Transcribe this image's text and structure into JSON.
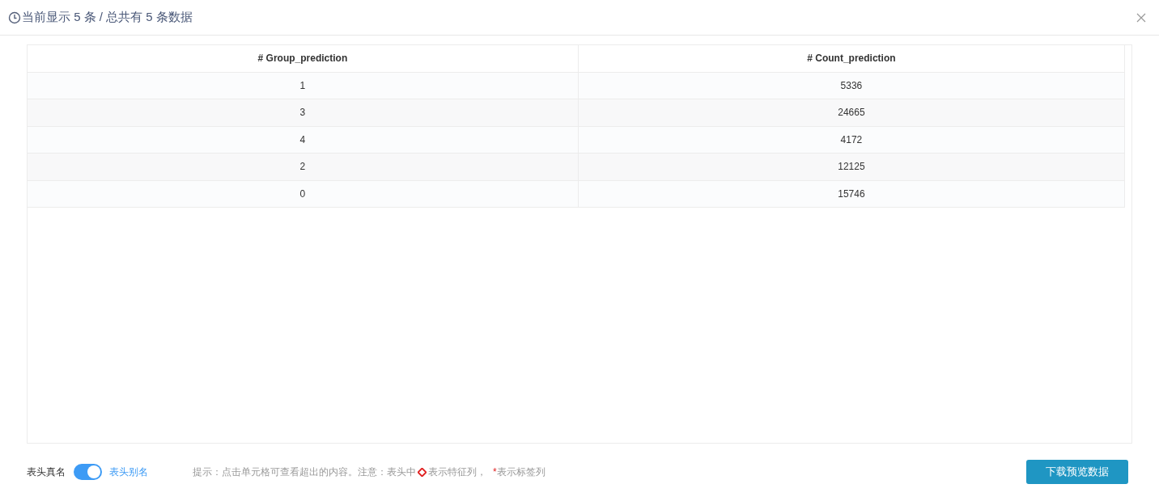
{
  "dialog": {
    "title": "当前显示 5 条 / 总共有 5 条数据"
  },
  "table": {
    "columns": [
      "# Group_prediction",
      "# Count_prediction"
    ],
    "rows": [
      [
        "1",
        "5336"
      ],
      [
        "3",
        "24665"
      ],
      [
        "4",
        "4172"
      ],
      [
        "2",
        "12125"
      ],
      [
        "0",
        "15746"
      ]
    ]
  },
  "footer": {
    "toggle": {
      "left_label": "表头真名",
      "right_label": "表头别名",
      "on": true
    },
    "hint": {
      "before": "提示：点击单元格可查看超出的内容。注意：表头中",
      "feature_text": "表示特征列，",
      "label_mark": "*",
      "after": "表示标签列"
    },
    "download_button": "下载预览数据"
  }
}
